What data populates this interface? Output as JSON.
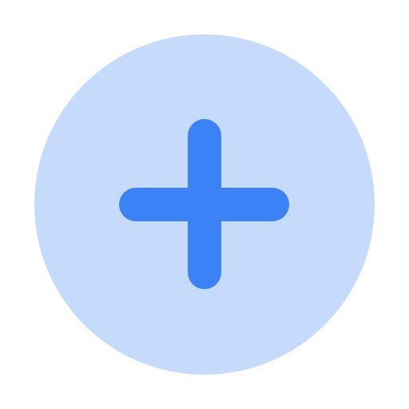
{
  "add_button": {
    "icon": "plus-icon",
    "colors": {
      "circle_fill": "#c6dbfb",
      "plus_stroke": "#3b82f6",
      "page_background": "#ffffff"
    }
  }
}
